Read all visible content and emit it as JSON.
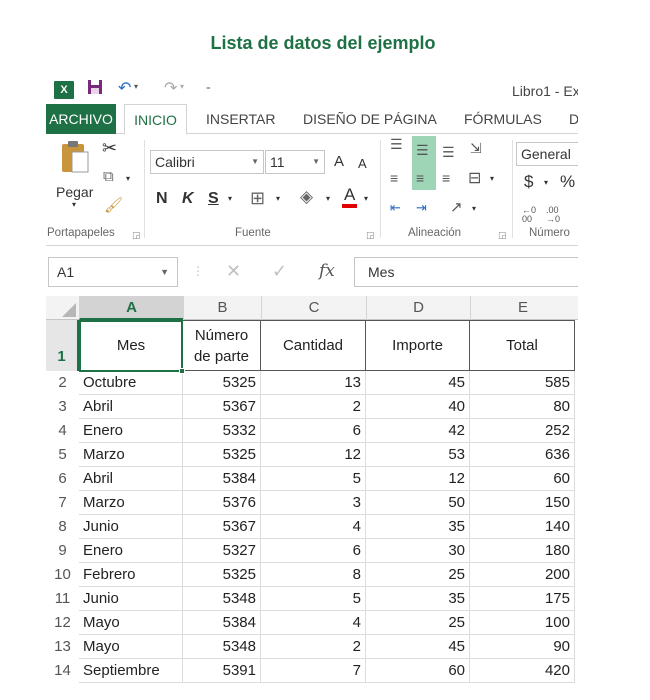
{
  "caption": "Lista de datos del ejemplo",
  "window": {
    "title": "Libro1 - Ex"
  },
  "tabs": {
    "file": "ARCHIVO",
    "items": [
      "INICIO",
      "INSERTAR",
      "DISEÑO DE PÁGINA",
      "FÓRMULAS",
      "D"
    ],
    "active": "INICIO"
  },
  "ribbon": {
    "clipboard": {
      "label": "Portapapeles",
      "paste": "Pegar"
    },
    "font": {
      "label": "Fuente",
      "name": "Calibri",
      "size": "11",
      "bold": "N",
      "italic": "K",
      "underline": "S",
      "grow": "A",
      "shrink": "A",
      "color_glyph": "A"
    },
    "alignment": {
      "label": "Alineación"
    },
    "number": {
      "label": "Número",
      "format": "General",
      "currency": "$",
      "percent": "%"
    }
  },
  "formula_bar": {
    "cell_ref": "A1",
    "fx": "fx",
    "content": "Mes"
  },
  "columns": [
    "A",
    "B",
    "C",
    "D",
    "E"
  ],
  "selected_column": "A",
  "header_row": {
    "number": "1",
    "cells": [
      "Mes",
      "Número de parte",
      "Cantidad",
      "Importe",
      "Total"
    ]
  },
  "rows": [
    {
      "n": "2",
      "mes": "Octubre",
      "parte": "5325",
      "cantidad": "13",
      "importe": "45",
      "total": "585"
    },
    {
      "n": "3",
      "mes": "Abril",
      "parte": "5367",
      "cantidad": "2",
      "importe": "40",
      "total": "80"
    },
    {
      "n": "4",
      "mes": "Enero",
      "parte": "5332",
      "cantidad": "6",
      "importe": "42",
      "total": "252"
    },
    {
      "n": "5",
      "mes": "Marzo",
      "parte": "5325",
      "cantidad": "12",
      "importe": "53",
      "total": "636"
    },
    {
      "n": "6",
      "mes": "Abril",
      "parte": "5384",
      "cantidad": "5",
      "importe": "12",
      "total": "60"
    },
    {
      "n": "7",
      "mes": "Marzo",
      "parte": "5376",
      "cantidad": "3",
      "importe": "50",
      "total": "150"
    },
    {
      "n": "8",
      "mes": "Junio",
      "parte": "5367",
      "cantidad": "4",
      "importe": "35",
      "total": "140"
    },
    {
      "n": "9",
      "mes": "Enero",
      "parte": "5327",
      "cantidad": "6",
      "importe": "30",
      "total": "180"
    },
    {
      "n": "10",
      "mes": "Febrero",
      "parte": "5325",
      "cantidad": "8",
      "importe": "25",
      "total": "200"
    },
    {
      "n": "11",
      "mes": "Junio",
      "parte": "5348",
      "cantidad": "5",
      "importe": "35",
      "total": "175"
    },
    {
      "n": "12",
      "mes": "Mayo",
      "parte": "5384",
      "cantidad": "4",
      "importe": "25",
      "total": "100"
    },
    {
      "n": "13",
      "mes": "Mayo",
      "parte": "5348",
      "cantidad": "2",
      "importe": "45",
      "total": "90"
    },
    {
      "n": "14",
      "mes": "Septiembre",
      "parte": "5391",
      "cantidad": "7",
      "importe": "60",
      "total": "420"
    }
  ],
  "colors": {
    "accent": "#1e7145",
    "selection_fill": "#9fd5b7"
  },
  "icons": [
    "excel-logo-icon",
    "save-icon",
    "undo-icon",
    "redo-icon",
    "customize-qat-icon",
    "paste-icon",
    "cut-icon",
    "copy-icon",
    "format-painter-icon",
    "borders-icon",
    "fill-color-icon",
    "font-color-icon",
    "align-top-icon",
    "align-middle-icon",
    "align-bottom-icon",
    "orientation-icon",
    "wrap-text-icon",
    "align-left-icon",
    "align-center-icon",
    "align-right-icon",
    "merge-center-icon",
    "decrease-indent-icon",
    "increase-indent-icon",
    "increase-decimal-icon",
    "decrease-decimal-icon",
    "cancel-icon",
    "enter-icon",
    "dialog-launcher-icon"
  ]
}
